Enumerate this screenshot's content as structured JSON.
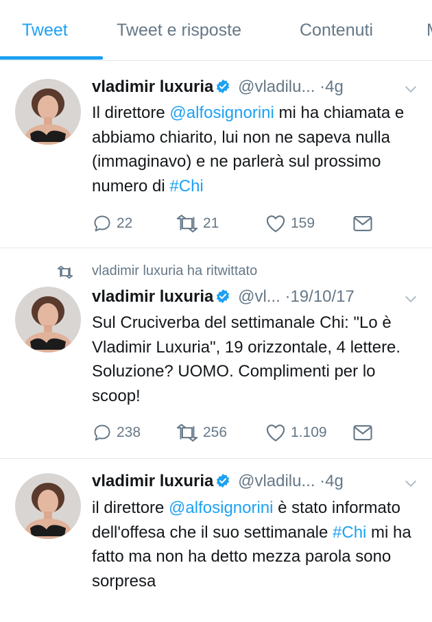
{
  "tabs": [
    {
      "label": "Tweet",
      "active": true
    },
    {
      "label": "Tweet e risposte",
      "active": false
    },
    {
      "label": "Contenuti",
      "active": false
    },
    {
      "label": "M",
      "active": false
    }
  ],
  "colors": {
    "accent": "#1da1f2",
    "secondary_text": "#657786",
    "divider": "#e1e8ed"
  },
  "tweets": [
    {
      "name": "vladimir luxuria",
      "handle": "@vladilu...",
      "dot": "·",
      "time": "4g",
      "text_parts": [
        "Il direttore ",
        "@alfosignorini",
        " mi ha chiamata e abbiamo chiarito, lui non ne sapeva nulla (immaginavo) e ne parlerà sul prossimo numero di ",
        "#Chi"
      ],
      "replies": "22",
      "retweets": "21",
      "likes": "159"
    },
    {
      "retweet_label": "vladimir luxuria ha ritwittato",
      "name": "vladimir luxuria",
      "handle": "@vl...",
      "dot": "·",
      "time": "19/10/17",
      "text_parts": [
        "Sul Cruciverba del settimanale Chi: \"Lo è Vladimir Luxuria\", 19 orizzontale, 4 lettere. Soluzione? UOMO. Complimenti per lo scoop!"
      ],
      "replies": "238",
      "retweets": "256",
      "likes": "1.109"
    },
    {
      "name": "vladimir luxuria",
      "handle": "@vladilu...",
      "dot": "·",
      "time": "4g",
      "text_parts": [
        "il direttore ",
        "@alfosignorini",
        " è stato informato dell'offesa che il suo settimanale ",
        "#Chi",
        " mi ha fatto ma non ha detto mezza parola sono sorpresa"
      ]
    }
  ],
  "icons": [
    "verified-badge-icon",
    "chevron-down-icon",
    "reply-icon",
    "retweet-icon",
    "like-icon",
    "message-icon"
  ]
}
